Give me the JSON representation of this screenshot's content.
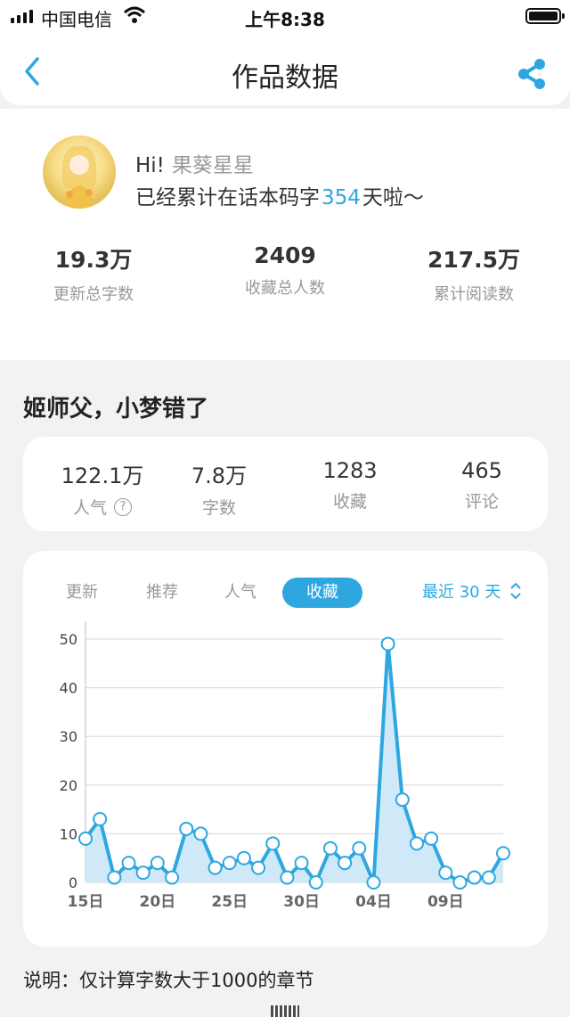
{
  "status_bar": {
    "carrier": "中国电信",
    "time": "上午8:38",
    "icons": [
      "signal-icon",
      "wifi-icon",
      "battery-icon"
    ]
  },
  "nav": {
    "title": "作品数据",
    "back_icon": "chevron-left-icon",
    "share_icon": "share-icon"
  },
  "profile": {
    "greeting": "Hi!",
    "username": "果葵星星",
    "accum_prefix": "已经累计在话本码字",
    "accum_days": "354",
    "accum_suffix": "天啦～",
    "stats": [
      {
        "value": "19.3万",
        "label": "更新总字数"
      },
      {
        "value": "2409",
        "label": "收藏总人数"
      },
      {
        "value": "217.5万",
        "label": "累计阅读数"
      }
    ]
  },
  "work": {
    "title": "姬师父，小梦错了",
    "stats": [
      {
        "value": "122.1万",
        "label": "人气",
        "help_icon": "question-circle-icon"
      },
      {
        "value": "7.8万",
        "label": "字数"
      },
      {
        "value": "1283",
        "label": "收藏"
      },
      {
        "value": "465",
        "label": "评论"
      }
    ]
  },
  "tabs": [
    {
      "label": "更新",
      "active": false
    },
    {
      "label": "推荐",
      "active": false
    },
    {
      "label": "人气",
      "active": false
    },
    {
      "label": "收藏",
      "active": true
    }
  ],
  "range_select": {
    "label": "最近 30 天",
    "icon": "updown-chevron-icon"
  },
  "colors": {
    "accent": "#2ea7e0",
    "area_fill": "#cfe9f8"
  },
  "chart_data": {
    "type": "area",
    "title": "",
    "xlabel": "",
    "ylabel": "",
    "ylim": [
      0,
      50
    ],
    "yticks": [
      0,
      10,
      20,
      30,
      40,
      50
    ],
    "x_tick_labels": [
      {
        "index": 0,
        "label": "15日"
      },
      {
        "index": 5,
        "label": "20日"
      },
      {
        "index": 10,
        "label": "25日"
      },
      {
        "index": 15,
        "label": "30日"
      },
      {
        "index": 20,
        "label": "04日"
      },
      {
        "index": 25,
        "label": "09日"
      }
    ],
    "series": [
      {
        "values": [
          9,
          13,
          1,
          4,
          2,
          4,
          1,
          11,
          10,
          3,
          4,
          5,
          3,
          8,
          1,
          4,
          0,
          7,
          4,
          7,
          0,
          49,
          17,
          8,
          9,
          2,
          0,
          1,
          1,
          6
        ]
      }
    ],
    "grid": true
  },
  "note": "说明：仅计算字数大于1000的章节"
}
